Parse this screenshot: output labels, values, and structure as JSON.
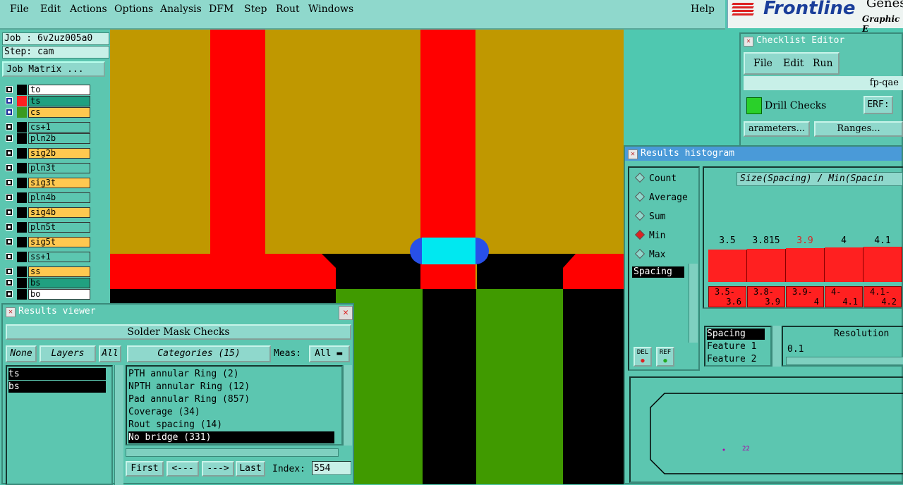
{
  "menu": {
    "items": [
      "File",
      "Edit",
      "Actions",
      "Options",
      "Analysis",
      "DFM",
      "Step",
      "Rout",
      "Windows"
    ],
    "help": "Help"
  },
  "logo": {
    "brand": "Frontline",
    "top": "Genesis",
    "sub": "Graphic E"
  },
  "job": {
    "job_label": "Job : 6v2uz005a0",
    "step_label": "Step: cam",
    "matrix_button": "Job Matrix ..."
  },
  "layers": [
    {
      "name": "to",
      "swatch": "#000000",
      "fill": "#ffffff"
    },
    {
      "name": "ts",
      "swatch": "#ff2020",
      "fill": "#20a080",
      "selected": true,
      "box": "#1a2a9a"
    },
    {
      "name": "cs",
      "swatch": "#3a9a20",
      "fill": "#ffc850",
      "box": "#1a2a9a"
    },
    {
      "name": "cs+1",
      "swatch": "#000000",
      "fill": "#5cc6b0"
    },
    {
      "name": "pln2b",
      "swatch": "#000000",
      "fill": "#5cc6b0"
    },
    {
      "name": "sig2b",
      "swatch": "#000000",
      "fill": "#ffc850"
    },
    {
      "name": "pln3t",
      "swatch": "#000000",
      "fill": "#5cc6b0"
    },
    {
      "name": "sig3t",
      "swatch": "#000000",
      "fill": "#ffc850"
    },
    {
      "name": "pln4b",
      "swatch": "#000000",
      "fill": "#5cc6b0"
    },
    {
      "name": "sig4b",
      "swatch": "#000000",
      "fill": "#ffc850"
    },
    {
      "name": "pln5t",
      "swatch": "#000000",
      "fill": "#5cc6b0"
    },
    {
      "name": "sig5t",
      "swatch": "#000000",
      "fill": "#ffc850"
    },
    {
      "name": "ss+1",
      "swatch": "#000000",
      "fill": "#5cc6b0"
    },
    {
      "name": "ss",
      "swatch": "#000000",
      "fill": "#ffc850"
    },
    {
      "name": "bs",
      "swatch": "#000000",
      "fill": "#20a080"
    },
    {
      "name": "bo",
      "swatch": "#000000",
      "fill": "#ffffff"
    }
  ],
  "checklist": {
    "title": "Checklist Editor",
    "menu": [
      "File",
      "Edit",
      "Run"
    ],
    "name": "fp-qae",
    "check": "Drill Checks",
    "erf": "ERF:",
    "params": "arameters...",
    "ranges": "Ranges..."
  },
  "histogram": {
    "title": "Results histogram",
    "modes": [
      "Count",
      "Average",
      "Sum",
      "Min",
      "Max"
    ],
    "selected_mode": "Min",
    "header": "Size(Spacing) / Min(Spacin",
    "types": [
      "Spacing"
    ],
    "del": "DEL",
    "ref": "REF",
    "measures": [
      "Spacing",
      "Feature 1",
      "Feature 2"
    ],
    "resolution_label": "Resolution",
    "resolution_value": "0.1",
    "bars": [
      {
        "value": "3.5",
        "range_a": "3.5-",
        "range_b": "3.6",
        "highlight": false
      },
      {
        "value": "3.815",
        "range_a": "3.8-",
        "range_b": "3.9",
        "highlight": false
      },
      {
        "value": "3.9",
        "range_a": "3.9-",
        "range_b": "4",
        "highlight": true
      },
      {
        "value": "4",
        "range_a": "4-",
        "range_b": "4.1",
        "highlight": false
      },
      {
        "value": "4.1",
        "range_a": "4.1-",
        "range_b": "4.2",
        "highlight": false
      }
    ],
    "preview_label": "22"
  },
  "viewer": {
    "title": "Results viewer",
    "heading": "Solder Mask Checks",
    "none": "None",
    "layers": "Layers",
    "all": "All",
    "layer_list": [
      "ts",
      "bs"
    ],
    "categories": "Categories (15)",
    "meas_label": "Meas:",
    "meas_value": "All",
    "category_list": [
      "PTH annular Ring (2)",
      "NPTH annular Ring (12)",
      "Pad annular Ring (857)",
      "Coverage (34)",
      "Rout spacing (14)",
      "No bridge (331)"
    ],
    "selected_category": "No bridge (331)",
    "nav": [
      "First",
      "<---",
      "--->",
      "Last"
    ],
    "index_label": "Index:",
    "index_value": "554"
  },
  "colors": {
    "panel": "#5cc6b0",
    "red": "#ff0000",
    "gold": "#c09800",
    "green": "#409a00",
    "cyan": "#00e8f0",
    "blue": "#2850e8"
  }
}
